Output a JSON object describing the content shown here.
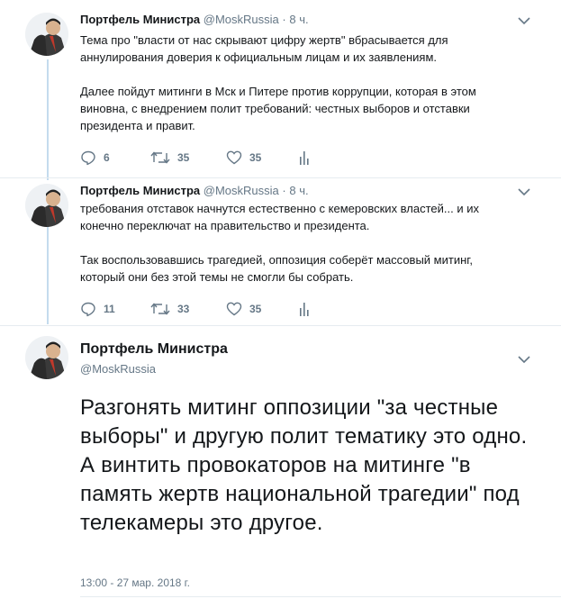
{
  "tweets": [
    {
      "name": "Портфель Министра",
      "handle": "@MoskRussia",
      "separator": "·",
      "time": "8 ч.",
      "paragraphs": [
        "Тема про \"власти от нас скрывают цифру жертв\" вбрасывается для аннулирования доверия к официальным лицам и их заявлениям.",
        "Далее пойдут митинги в Мск и Питере против коррупции, которая в этом виновна, с внедрением полит требований: честных выборов и отставки президента и правит."
      ],
      "replies": "6",
      "retweets": "35",
      "likes": "35"
    },
    {
      "name": "Портфель Министра",
      "handle": "@MoskRussia",
      "separator": "·",
      "time": "8 ч.",
      "paragraphs": [
        "требования отставок начнутся естественно с кемеровских властей... и их конечно переключат на правительство и президента.",
        "Так воспользовавшись трагедией, оппозиция соберёт массовый митинг, который они без этой темы не смогли бы собрать."
      ],
      "replies": "11",
      "retweets": "33",
      "likes": "35"
    }
  ],
  "main_tweet": {
    "name": "Портфель Министра",
    "handle": "@MoskRussia",
    "text": "Разгонять митинг оппозиции \"за честные выборы\" и другую полит тематику это одно. А винтить провокаторов на митинге \"в память жертв национальной трагедии\" под телекамеры это другое.",
    "timestamp": "13:00 - 27 мар. 2018 г."
  },
  "colors": {
    "accent": "#1da1f2",
    "muted": "#657786",
    "thread_line": "#c4dbee"
  }
}
